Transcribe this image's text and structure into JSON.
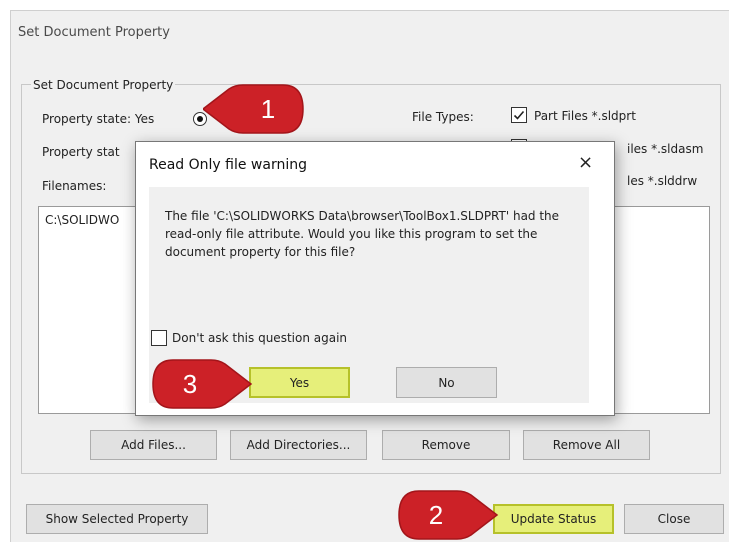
{
  "window": {
    "title": "Set Document Property",
    "group_label": "Set Document Property",
    "property_state_yes": "Property state: Yes",
    "property_state_no": "Property stat",
    "file_types_label": "File Types:",
    "file_types": [
      {
        "label": "Part Files *.sldprt",
        "checked": true
      },
      {
        "label": "iles *.sldasm",
        "checked": false
      },
      {
        "label": "les *.slddrw",
        "checked": false
      }
    ],
    "filenames_label": "Filenames:",
    "filenames": [
      "C:\\SOLIDWO"
    ],
    "buttons": {
      "add_files": "Add Files...",
      "add_directories": "Add Directories...",
      "remove": "Remove",
      "remove_all": "Remove All",
      "show_selected": "Show Selected Property",
      "update_status": "Update Status",
      "close": "Close"
    }
  },
  "dialog": {
    "title": "Read Only file warning",
    "close_glyph": "×",
    "message": "The file 'C:\\SOLIDWORKS Data\\browser\\ToolBox1.SLDPRT' had the read-only file attribute.  Would you like this program to set the document property for this file?",
    "dont_ask_label": "Don't ask this question again",
    "dont_ask_checked": false,
    "yes_label": "Yes",
    "no_label": "No"
  },
  "callouts": [
    "1",
    "2",
    "3"
  ],
  "colors": {
    "callout_red": "#cc2127",
    "highlight_yellow": "#e6ef7a",
    "highlight_border": "#b6c12a",
    "dialog_panel": "#f0f0f0"
  }
}
